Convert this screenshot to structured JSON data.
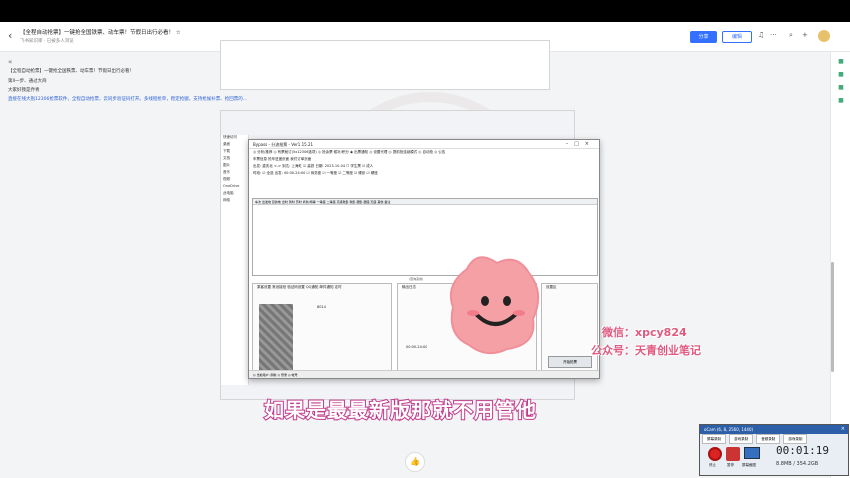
{
  "doc": {
    "title": "【全程自动抢票】一键抢全国铁票、动车票！节假日出行必看！ ☆",
    "meta": "飞书知识库 · 已被多人浏览",
    "lines": [
      "【全程自动抢票】一键抢全国铁票、动车票！节假日出行必看！",
      "第II一步、通过大商",
      "大家好我是乔青",
      "直接在线大抱12306抢票软件，全程自动抢票，云同步验证码打开。多线程抢单，稳定抢腿，支持抢候补票、抢回票的..."
    ]
  },
  "toolbar": {
    "share": "分享",
    "edit": "编辑",
    "more": "···",
    "plus": "+"
  },
  "app": {
    "title": "Bypass - 分流抢票 - Ver1.15.21",
    "row1": "◎ 分析/推荐  ◎ 有票就订(5x12306选项)  ◎ 抢余票 候补/积分  ◉ 出票通知  ◎ 设置代理  ◎ 提前抢连续模式  ◎ 自动抢  ◎ 公告",
    "row2": "车票信息    抢车进度页面    我们订单页面",
    "row3": "出发: 重庆北  <->  到达: 上海虹  ☑ 高铁  日期: 2023-10-04  ☐ 学生票  ☑ 成人",
    "row4": "时段: ☑ 全选  出发: 00:00-24:00  ☑ 商务座  ☑ 一等座  ☑ 二等座  ☑ 硬卧  ☑ 硬座",
    "grid_head": "车次  出发地  目的地  出时  到时  历时  商务/特等  一等座  二等座  高级软卧  软卧  硬卧  硬座  无座  其他  备注",
    "caption": "(查询完成)",
    "panel1": "乘客设置  常设接班  验证码设置  QQ通知  邮件通知  定时",
    "panel2": "输出日志",
    "panel3": "设置区",
    "start": "开始抢票",
    "status": "◎ 当前用户: 刷新  ◎ 登录  ◎ 帐号",
    "panel_time": "00:00-24:00",
    "panel_code": "8014"
  },
  "explorer": [
    "快速访问",
    "桌面",
    "下载",
    "文档",
    "图片",
    "音乐",
    "视频",
    "OneDrive",
    "此电脑",
    "网络"
  ],
  "watermark": {
    "wechat": "微信：xpcy824",
    "account": "公众号：天青创业笔记"
  },
  "subtitle": "如果是最最新版那就不用管他",
  "recorder": {
    "title": "oCam (6, 8, 2560, 1440)",
    "tabs": [
      "屏幕录制",
      "游戏录制",
      "音频录制",
      "游戏录制"
    ],
    "stop": "停止",
    "pause": "暂停",
    "screen": "屏幕截图",
    "time": "00:01:19",
    "size": "8.8MB / 354.2GB"
  }
}
